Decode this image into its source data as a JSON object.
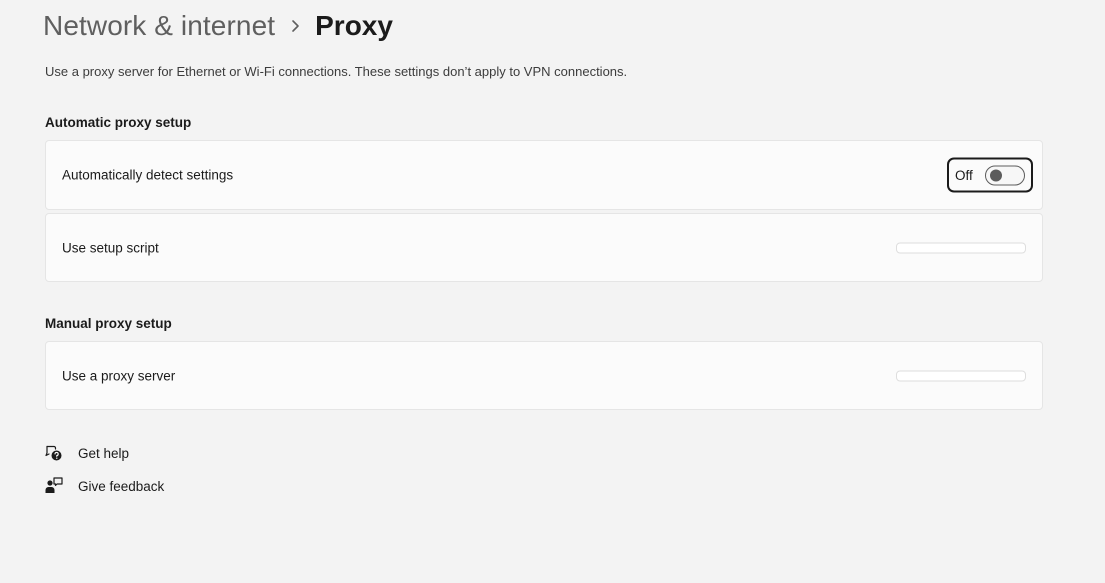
{
  "breadcrumb": {
    "parent": "Network & internet",
    "current": "Proxy"
  },
  "description": "Use a proxy server for Ethernet or Wi-Fi connections. These settings don’t apply to VPN connections.",
  "automatic": {
    "title": "Automatic proxy setup",
    "detect": {
      "label": "Automatically detect settings",
      "toggle_state": "Off"
    },
    "script": {
      "label": "Use setup script"
    }
  },
  "manual": {
    "title": "Manual proxy setup",
    "proxy_server": {
      "label": "Use a proxy server"
    }
  },
  "links": {
    "help": "Get help",
    "feedback": "Give feedback"
  },
  "icons": {
    "breadcrumb_separator": "chevron-right-icon",
    "help": "get-help-icon",
    "feedback": "give-feedback-icon"
  },
  "colors": {
    "background": "#f3f3f3",
    "card": "#fbfbfb",
    "text": "#1b1b1b",
    "toggle_off": "#5c5c5c"
  }
}
